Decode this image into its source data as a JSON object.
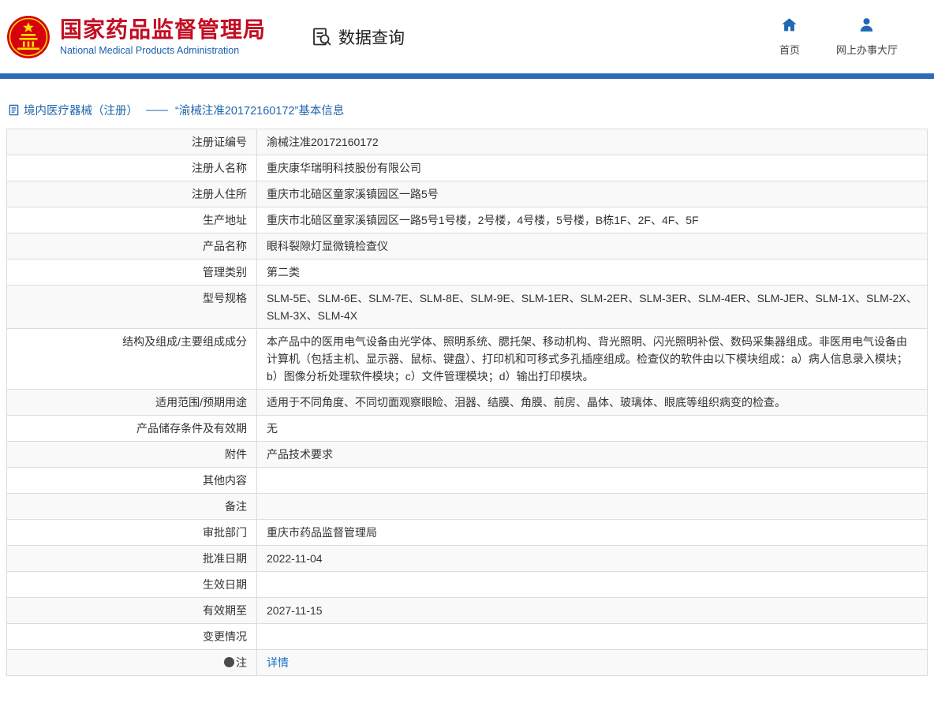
{
  "header": {
    "org_name_cn": "国家药品监督管理局",
    "org_name_en": "National Medical Products Administration",
    "section_title": "数据查询",
    "nav": [
      {
        "label": "首页",
        "icon": "home-icon"
      },
      {
        "label": "网上办事大厅",
        "icon": "user-icon"
      }
    ]
  },
  "colors": {
    "brand_red": "#c30d23",
    "brand_blue": "#1b5fae",
    "bar_blue": "#2e6cb5",
    "link_blue": "#1f6ec7"
  },
  "breadcrumb": {
    "category": "境内医疗器械（注册）",
    "separator": "——",
    "title": "“渝械注准20172160172”基本信息"
  },
  "table": {
    "rows": [
      {
        "label": "注册证编号",
        "value": "渝械注准20172160172"
      },
      {
        "label": "注册人名称",
        "value": "重庆康华瑞明科技股份有限公司"
      },
      {
        "label": "注册人住所",
        "value": "重庆市北碚区童家溪镇园区一路5号"
      },
      {
        "label": "生产地址",
        "value": "重庆市北碚区童家溪镇园区一路5号1号楼，2号楼，4号楼，5号楼，B栋1F、2F、4F、5F"
      },
      {
        "label": "产品名称",
        "value": "眼科裂隙灯显微镜检查仪"
      },
      {
        "label": "管理类别",
        "value": "第二类"
      },
      {
        "label": "型号规格",
        "value": "SLM-5E、SLM-6E、SLM-7E、SLM-8E、SLM-9E、SLM-1ER、SLM-2ER、SLM-3ER、SLM-4ER、SLM-JER、SLM-1X、SLM-2X、SLM-3X、SLM-4X"
      },
      {
        "label": "结构及组成/主要组成成分",
        "value": "本产品中的医用电气设备由光学体、照明系统、腮托架、移动机构、背光照明、闪光照明补偿、数码采集器组成。非医用电气设备由计算机（包括主机、显示器、鼠标、键盘）、打印机和可移式多孔插座组成。检查仪的软件由以下模块组成：a）病人信息录入模块；\nb）图像分析处理软件模块；c）文件管理模块；d）输出打印模块。"
      },
      {
        "label": "适用范围/预期用途",
        "value": "适用于不同角度、不同切面观察眼睑、泪器、结膜、角膜、前房、晶体、玻璃体、眼底等组织病变的检查。"
      },
      {
        "label": "产品储存条件及有效期",
        "value": "无"
      },
      {
        "label": "附件",
        "value": "产品技术要求"
      },
      {
        "label": "其他内容",
        "value": ""
      },
      {
        "label": "备注",
        "value": ""
      },
      {
        "label": "审批部门",
        "value": "重庆市药品监督管理局"
      },
      {
        "label": "批准日期",
        "value": "2022-11-04"
      },
      {
        "label": "生效日期",
        "value": ""
      },
      {
        "label": "有效期至",
        "value": "2027-11-15"
      },
      {
        "label": "变更情况",
        "value": ""
      },
      {
        "label": "注",
        "value": "详情",
        "link": true,
        "icon": "note-icon"
      }
    ]
  }
}
